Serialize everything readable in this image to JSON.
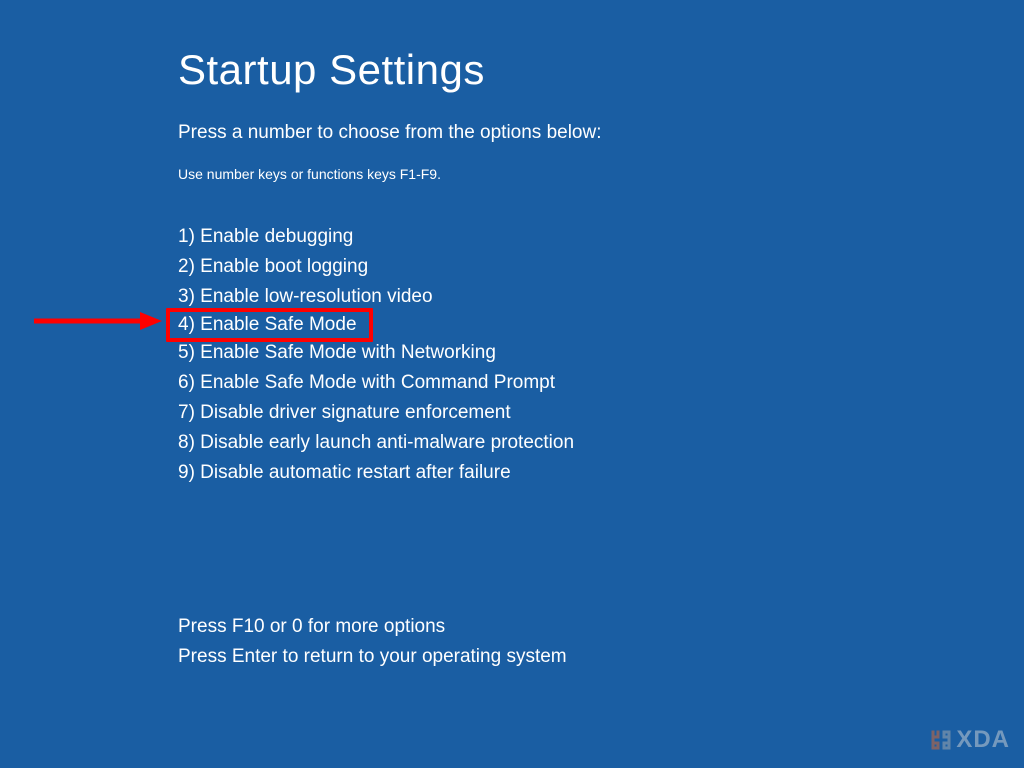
{
  "title": "Startup Settings",
  "subtitle": "Press a number to choose from the options below:",
  "hint": "Use number keys or functions keys F1-F9.",
  "options": [
    {
      "label": "1) Enable debugging",
      "highlighted": false
    },
    {
      "label": "2) Enable boot logging",
      "highlighted": false
    },
    {
      "label": "3) Enable low-resolution video",
      "highlighted": false
    },
    {
      "label": "4) Enable Safe Mode",
      "highlighted": true
    },
    {
      "label": "5) Enable Safe Mode with Networking",
      "highlighted": false
    },
    {
      "label": "6) Enable Safe Mode with Command Prompt",
      "highlighted": false
    },
    {
      "label": "7) Disable driver signature enforcement",
      "highlighted": false
    },
    {
      "label": "8) Disable early launch anti-malware protection",
      "highlighted": false
    },
    {
      "label": "9) Disable automatic restart after failure",
      "highlighted": false
    }
  ],
  "footer": {
    "line1": "Press F10 or 0 for more options",
    "line2": "Press Enter to return to your operating system"
  },
  "annotation": {
    "arrow_color": "#ff0000",
    "highlight_color": "#ff0000"
  },
  "watermark": {
    "text": "XDA"
  }
}
